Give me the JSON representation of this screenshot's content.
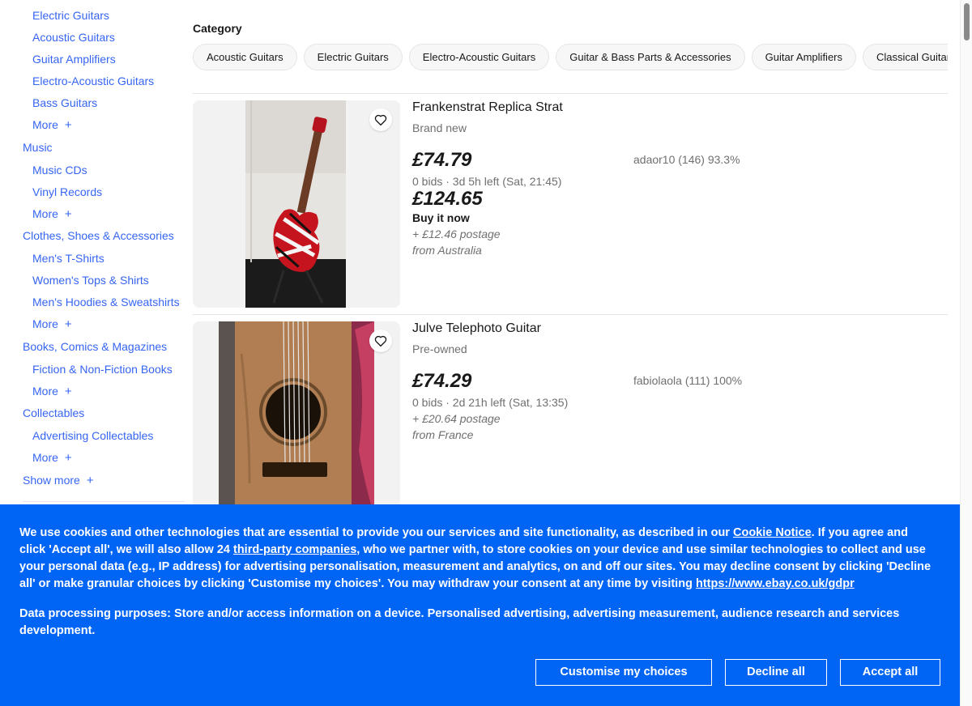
{
  "sidebar": {
    "items": [
      {
        "label": "Electric Guitars",
        "level": 2
      },
      {
        "label": "Acoustic Guitars",
        "level": 2
      },
      {
        "label": "Guitar Amplifiers",
        "level": 2
      },
      {
        "label": "Electro-Acoustic Guitars",
        "level": 2
      },
      {
        "label": "Bass Guitars",
        "level": 2
      },
      {
        "label": "More",
        "level": 2,
        "more": true
      },
      {
        "label": "Music",
        "level": 1
      },
      {
        "label": "Music CDs",
        "level": 2
      },
      {
        "label": "Vinyl Records",
        "level": 2
      },
      {
        "label": "More",
        "level": 2,
        "more": true
      },
      {
        "label": "Clothes, Shoes & Accessories",
        "level": 1
      },
      {
        "label": "Men's T-Shirts",
        "level": 2
      },
      {
        "label": "Women's Tops & Shirts",
        "level": 2
      },
      {
        "label": "Men's Hoodies & Sweatshirts",
        "level": 2
      },
      {
        "label": "More",
        "level": 2,
        "more": true
      },
      {
        "label": "Books, Comics & Magazines",
        "level": 1
      },
      {
        "label": "Fiction & Non-Fiction Books",
        "level": 2
      },
      {
        "label": "More",
        "level": 2,
        "more": true
      },
      {
        "label": "Collectables",
        "level": 1
      },
      {
        "label": "Advertising Collectables",
        "level": 2
      },
      {
        "label": "More",
        "level": 2,
        "more": true
      }
    ],
    "show_more": "Show more",
    "plus_glyph": "+"
  },
  "category": {
    "heading": "Category",
    "chips": [
      "Acoustic Guitars",
      "Electric Guitars",
      "Electro-Acoustic Guitars",
      "Guitar & Bass Parts & Accessories",
      "Guitar Amplifiers",
      "Classical Guitars"
    ]
  },
  "listings": [
    {
      "title": "Frankenstrat Replica Strat",
      "condition": "Brand new",
      "auction_price": "£74.79",
      "bids": "0 bids · 3d 5h left (Sat, 21:45)",
      "bin_price": "£124.65",
      "bin_label": "Buy it now",
      "postage": "+ £12.46 postage",
      "origin": "from Australia",
      "seller": "adaor10 (146) 93.3%"
    },
    {
      "title": "Julve Telephoto Guitar",
      "condition": "Pre-owned",
      "auction_price": "£74.29",
      "bids": "0 bids · 2d 21h left (Sat, 13:35)",
      "postage": "+ £20.64 postage",
      "origin": "from France",
      "seller": "fabiolaola (111) 100%"
    }
  ],
  "cookie": {
    "text_1": "We use cookies and other technologies that are essential to provide you our services and site functionality, as described in our ",
    "link_notice": "Cookie Notice",
    "text_2": ". If you agree and click 'Accept all', we will also allow 24 ",
    "link_third_party": "third-party companies",
    "text_3": ", who we partner with, to store cookies on your device and use similar technologies to collect and use your personal data (e.g., IP address) for advertising personalisation, measurement and analytics, on and off our sites. You may decline consent by clicking 'Decline all' or make granular choices by clicking 'Customise my choices'. You may withdraw your consent at any time by visiting ",
    "link_gdpr": "https://www.ebay.co.uk/gdpr",
    "purposes": "Data processing purposes: Store and/or access information on a device. Personalised advertising, advertising measurement, audience research and services development.",
    "btn_customise": "Customise my choices",
    "btn_decline": "Decline all",
    "btn_accept": "Accept all"
  },
  "colors": {
    "link": "#3665f3",
    "banner": "#0064f5"
  }
}
